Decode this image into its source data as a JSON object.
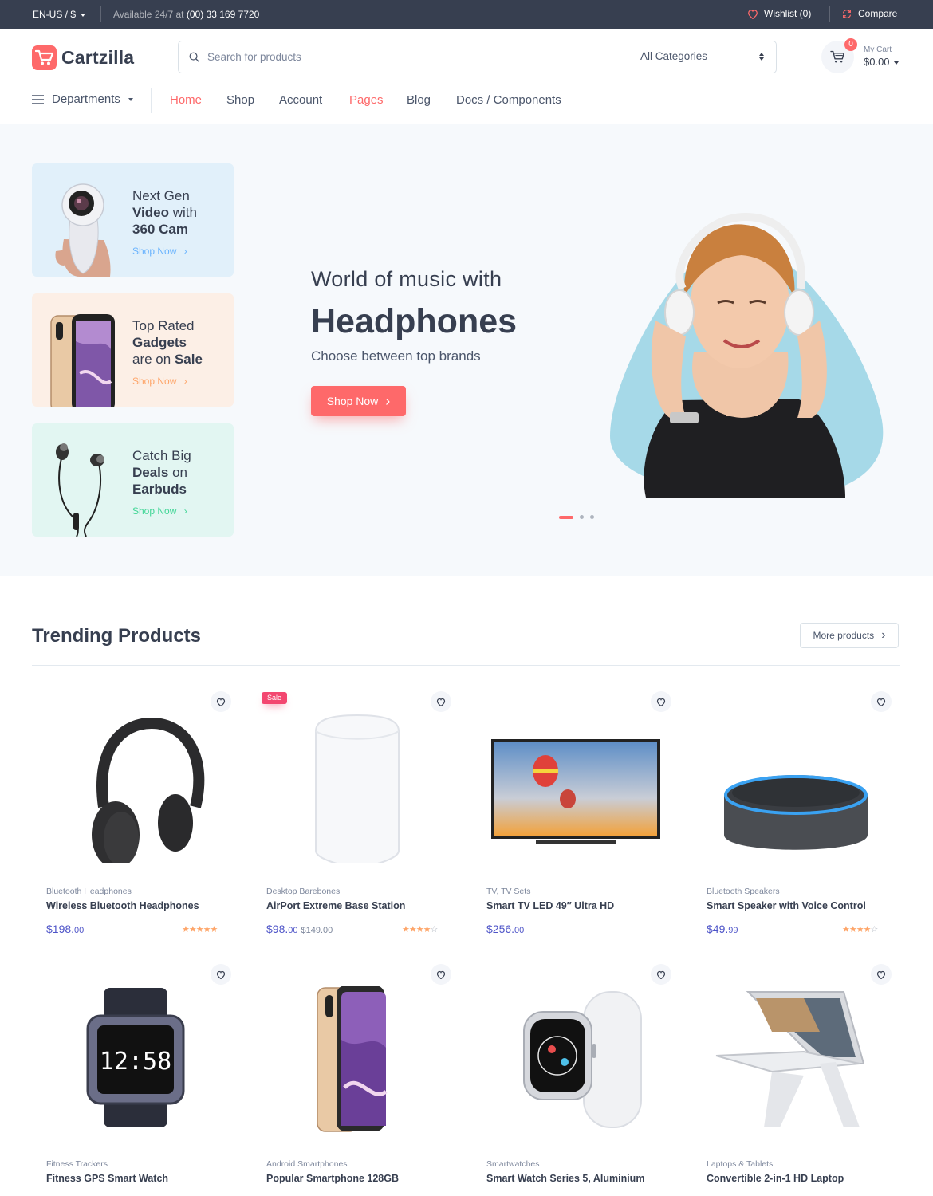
{
  "topbar": {
    "locale": "EN-US / $",
    "availability_prefix": "Available 24/7 at",
    "phone": "(00) 33 169 7720",
    "wishlist": "Wishlist (0)",
    "compare": "Compare"
  },
  "header": {
    "logo": "Cartzilla",
    "search_placeholder": "Search for products",
    "category_select": "All Categories",
    "cart_count": "0",
    "cart_label": "My Cart",
    "cart_total": "$0.00"
  },
  "nav": {
    "departments": "Departments",
    "links": [
      "Home",
      "Shop",
      "Account",
      "Pages",
      "Blog",
      "Docs / Components"
    ]
  },
  "promos": [
    {
      "line1": "Next Gen",
      "line2_bold": "Video",
      "line2_rest": " with",
      "line3_bold": "360 Cam",
      "cta": "Shop Now",
      "bg": "#e1f0fa",
      "accent": "#69b3fe"
    },
    {
      "line1": "Top Rated",
      "line2_bold": "Gadgets",
      "line3_pre": "are on ",
      "line3_bold": "Sale",
      "cta": "Shop Now",
      "bg": "#fcefe6",
      "accent": "#fea569"
    },
    {
      "line1": "Catch Big",
      "line2_bold": "Deals",
      "line2_rest": " on",
      "line3_bold": "Earbuds",
      "cta": "Shop Now",
      "bg": "#e2f6f2",
      "accent": "#42d697"
    }
  ],
  "hero": {
    "title1": "World of music with",
    "title2": "Headphones",
    "subtitle": "Choose between top brands",
    "cta": "Shop Now",
    "slides": 3,
    "active_slide": 1
  },
  "trending": {
    "title": "Trending Products",
    "more": "More products",
    "products": [
      {
        "category": "Bluetooth Headphones",
        "name": "Wireless Bluetooth Headphones",
        "price_main": "$198.",
        "price_cents": "00",
        "rating": 5,
        "icon": "headphones"
      },
      {
        "category": "Desktop Barebones",
        "name": "AirPort Extreme Base Station",
        "price_main": "$98.",
        "price_cents": "00",
        "old_price": "$149.00",
        "badge": "Sale",
        "rating": 4,
        "icon": "router"
      },
      {
        "category": "TV, TV Sets",
        "name": "Smart TV LED 49″ Ultra HD",
        "price_main": "$256.",
        "price_cents": "00",
        "icon": "tv"
      },
      {
        "category": "Bluetooth Speakers",
        "name": "Smart Speaker with Voice Control",
        "price_main": "$49.",
        "price_cents": "99",
        "rating": 4,
        "icon": "speaker"
      },
      {
        "category": "Fitness Trackers",
        "name": "Fitness GPS Smart Watch",
        "icon": "fitness-watch",
        "watch_time": "12:58"
      },
      {
        "category": "Android Smartphones",
        "name": "Popular Smartphone 128GB",
        "icon": "smartphone"
      },
      {
        "category": "Smartwatches",
        "name": "Smart Watch Series 5, Aluminium",
        "icon": "smartwatch"
      },
      {
        "category": "Laptops & Tablets",
        "name": "Convertible 2-in-1 HD Laptop",
        "icon": "laptop"
      }
    ]
  },
  "colors": {
    "accent": "#fe696a",
    "dark": "#373f50",
    "price": "#4e54c8",
    "star": "#fea569",
    "sale": "#f34770"
  }
}
